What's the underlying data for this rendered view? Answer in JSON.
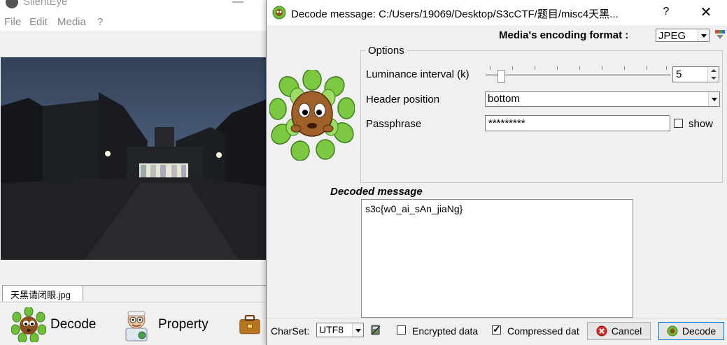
{
  "main_window": {
    "title": "SilentEye",
    "menu": [
      "File",
      "Edit",
      "Media",
      "?"
    ],
    "file_tab": "天黑请闭眼.jpg",
    "actions": {
      "decode_label": "Decode",
      "property_label": "Property"
    }
  },
  "dialog": {
    "title": "Decode message: C:/Users/19069/Desktop/S3cCTF/题目/misc4天黑...",
    "help_label": "?",
    "close_label": "✕",
    "encoding_label": "Media's encoding format :",
    "encoding_value": "JPEG",
    "options_title": "Options",
    "luminance_label": "Luminance interval (k)",
    "luminance_value": "5",
    "header_position_label": "Header position",
    "header_position_value": "bottom",
    "passphrase_label": "Passphrase",
    "passphrase_value": "*********",
    "show_label": "show",
    "show_checked": false,
    "decoded_label": "Decoded message",
    "decoded_message": "s3c{w0_ai_sAn_jiaNg}",
    "charset_label": "CharSet:",
    "charset_value": "UTF8",
    "encrypted_label": "Encrypted data",
    "encrypted_checked": false,
    "compressed_label": "Compressed dat",
    "compressed_checked": true,
    "cancel_label": "Cancel",
    "decode_label": "Decode"
  }
}
